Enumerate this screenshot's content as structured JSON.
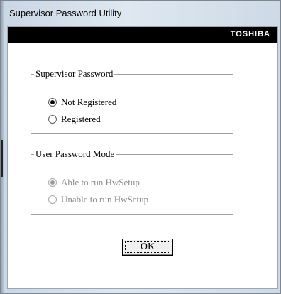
{
  "window": {
    "title": "Supervisor Password Utility"
  },
  "brand": {
    "name": "TOSHIBA"
  },
  "supervisor_group": {
    "legend": "Supervisor Password",
    "options": [
      {
        "label": "Not Registered",
        "selected": true
      },
      {
        "label": "Registered",
        "selected": false
      }
    ]
  },
  "user_group": {
    "legend": "User Password Mode",
    "enabled": false,
    "options": [
      {
        "label": "Able to run HwSetup",
        "selected": true
      },
      {
        "label": "Unable to run HwSetup",
        "selected": false
      }
    ]
  },
  "ok_button": {
    "label": "OK"
  }
}
